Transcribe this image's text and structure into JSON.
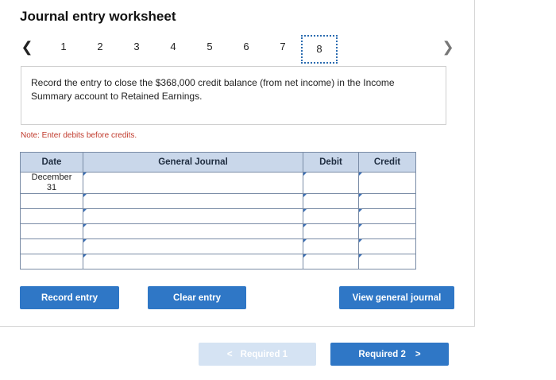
{
  "title": "Journal entry worksheet",
  "nav": {
    "prev_icon": "chevron-left-icon",
    "next_icon": "chevron-right-icon",
    "steps": [
      "1",
      "2",
      "3",
      "4",
      "5",
      "6",
      "7",
      "8"
    ],
    "active_step": "8"
  },
  "prompt": "Record the entry to close the $368,000 credit balance (from net income) in the Income Summary account to Retained Earnings.",
  "note": "Note: Enter debits before credits.",
  "table": {
    "headers": {
      "date": "Date",
      "journal": "General Journal",
      "debit": "Debit",
      "credit": "Credit"
    },
    "date_month": "December",
    "date_day": "31"
  },
  "buttons": {
    "record": "Record entry",
    "clear": "Clear entry",
    "view": "View general journal"
  },
  "footer": {
    "prev": "Required 1",
    "next": "Required 2"
  },
  "colors": {
    "accent": "#2f77c6",
    "header_bg": "#c9d7ea",
    "note": "#c0392b"
  }
}
